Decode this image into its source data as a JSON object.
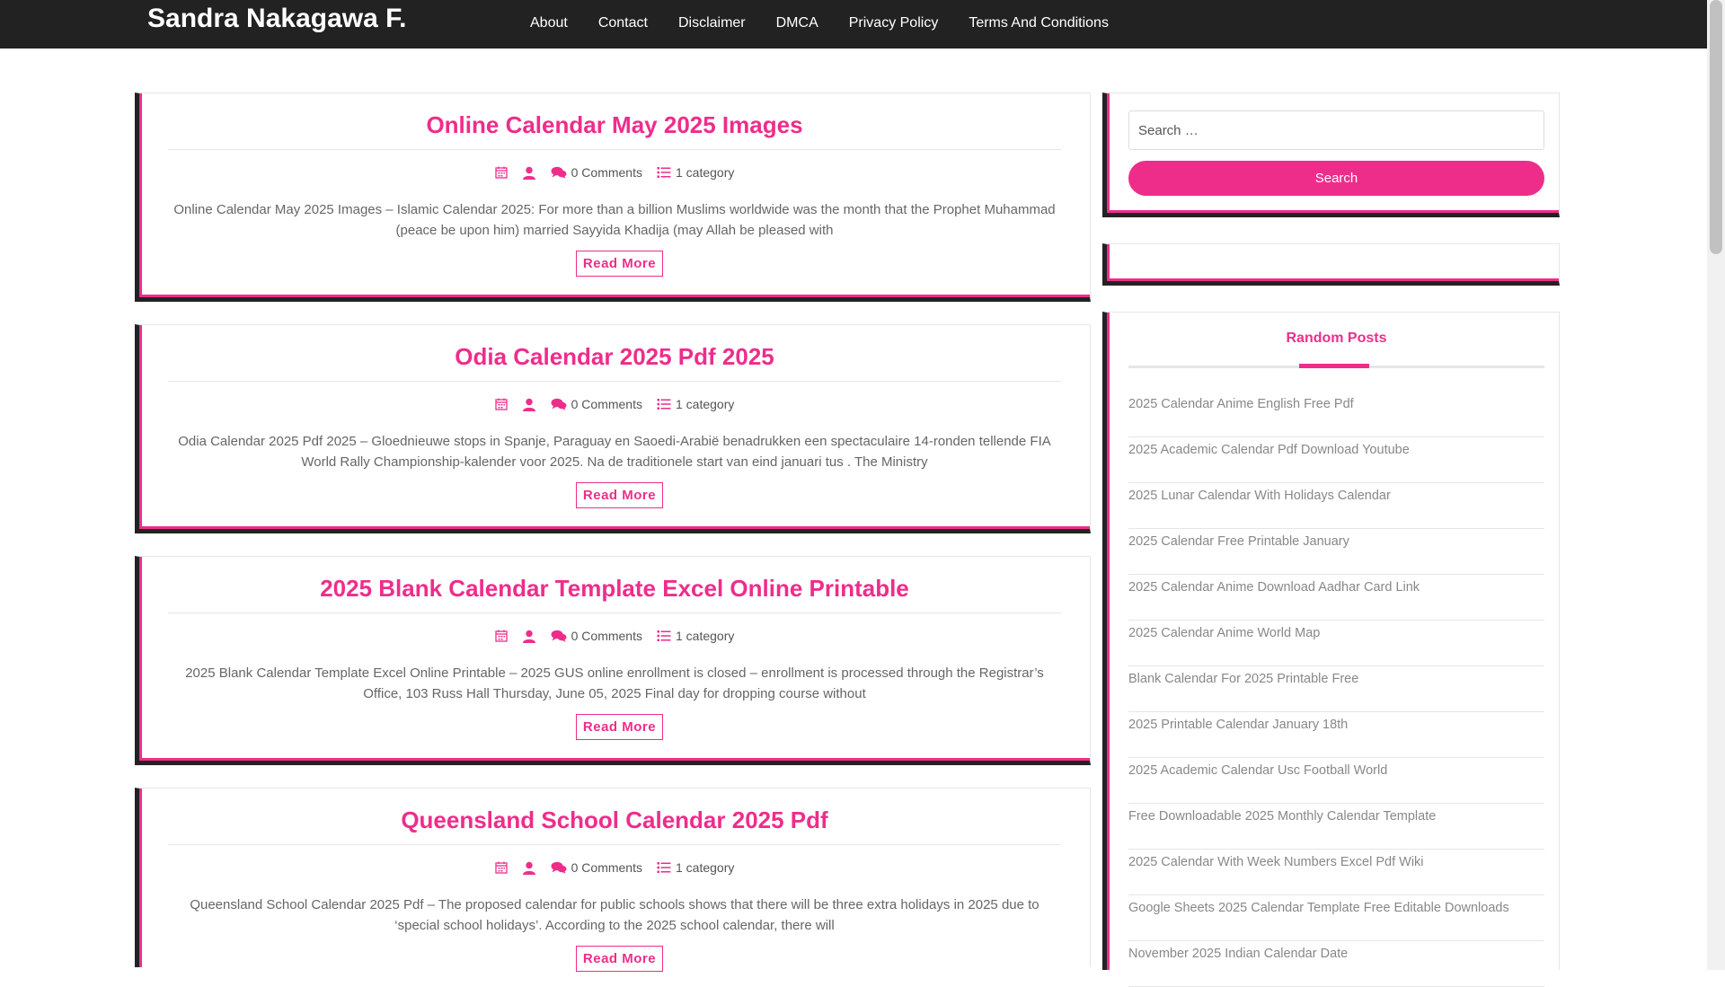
{
  "header": {
    "brand": "Sandra Nakagawa F.",
    "nav": [
      "About",
      "Contact",
      "Disclaimer",
      "DMCA",
      "Privacy Policy",
      "Terms And Conditions"
    ]
  },
  "colors": {
    "accent": "#ee2d8b",
    "header_bg": "#222222"
  },
  "posts": [
    {
      "title": "Online Calendar May 2025 Images",
      "comments": "0 Comments",
      "category": "1 category",
      "excerpt": "Online Calendar May 2025 Images – Islamic Calendar 2025: For more than a billion Muslims worldwide was the month that the Prophet Muhammad (peace be upon him) married Sayyida Khadija (may Allah be pleased with",
      "read_more": "Read More"
    },
    {
      "title": "Odia Calendar 2025 Pdf 2025",
      "comments": "0 Comments",
      "category": "1 category",
      "excerpt": "Odia Calendar 2025 Pdf 2025 – Gloednieuwe stops in Spanje, Paraguay en Saoedi-Arabië benadrukken een spectaculaire 14-ronden tellende FIA World Rally Championship-kalender voor 2025. Na de traditionele start van eind januari tus . The Ministry",
      "read_more": "Read More"
    },
    {
      "title": "2025 Blank Calendar Template Excel Online Printable",
      "comments": "0 Comments",
      "category": "1 category",
      "excerpt": "2025 Blank Calendar Template Excel Online Printable – 2025 GUS online enrollment is closed – enrollment is processed through the Registrar’s Office, 103 Russ Hall Thursday, June 05, 2025 Final day for dropping course without",
      "read_more": "Read More"
    },
    {
      "title": "Queensland School Calendar 2025 Pdf",
      "comments": "0 Comments",
      "category": "1 category",
      "excerpt": "Queensland School Calendar 2025 Pdf – The proposed calendar for public schools shows that there will be three extra holidays in 2025 due to ‘special school holidays’. According to the 2025 school calendar, there will",
      "read_more": "Read More"
    }
  ],
  "sidebar": {
    "search": {
      "placeholder": "Search …",
      "button": "Search"
    },
    "random_posts": {
      "title": "Random Posts",
      "items": [
        "2025 Calendar Anime English Free Pdf",
        "2025 Academic Calendar Pdf Download Youtube",
        "2025 Lunar Calendar With Holidays Calendar",
        "2025 Calendar Free Printable January",
        "2025 Calendar Anime Download Aadhar Card Link",
        "2025 Calendar Anime World Map",
        "Blank Calendar For 2025 Printable Free",
        "2025 Printable Calendar January 18th",
        "2025 Academic Calendar Usc Football World",
        "Free Downloadable 2025 Monthly Calendar Template",
        "2025 Calendar With Week Numbers Excel Pdf Wiki",
        "Google Sheets 2025 Calendar Template Free Editable Downloads",
        "November 2025 Indian Calendar Date"
      ]
    }
  }
}
